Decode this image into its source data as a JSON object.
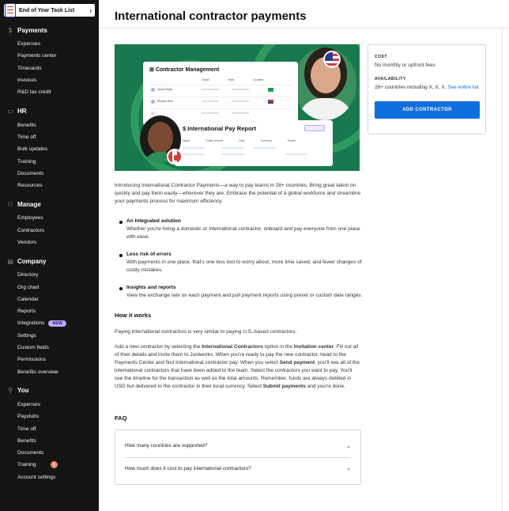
{
  "banner": {
    "text": "End of Year Task List",
    "chevron": "›"
  },
  "sidebar": {
    "sections": [
      {
        "title": "Payments",
        "icon": "dollar-icon",
        "glyph": "$",
        "items": [
          {
            "label": "Expenses"
          },
          {
            "label": "Payments center"
          },
          {
            "label": "Timecards"
          },
          {
            "label": "Invoices"
          },
          {
            "label": "R&D tax credit"
          }
        ]
      },
      {
        "title": "HR",
        "icon": "briefcase-icon",
        "glyph": "▭",
        "items": [
          {
            "label": "Benefits"
          },
          {
            "label": "Time off"
          },
          {
            "label": "Bulk updates"
          },
          {
            "label": "Training"
          },
          {
            "label": "Documents"
          },
          {
            "label": "Resources"
          }
        ]
      },
      {
        "title": "Manage",
        "icon": "people-icon",
        "glyph": "⚇",
        "items": [
          {
            "label": "Employees"
          },
          {
            "label": "Contractors"
          },
          {
            "label": "Vendors"
          }
        ]
      },
      {
        "title": "Company",
        "icon": "building-icon",
        "glyph": "▤",
        "items": [
          {
            "label": "Directory"
          },
          {
            "label": "Org chart"
          },
          {
            "label": "Calendar"
          },
          {
            "label": "Reports"
          },
          {
            "label": "Integrations",
            "badge": "NEW"
          },
          {
            "label": "Settings"
          },
          {
            "label": "Custom fields"
          },
          {
            "label": "Permissions"
          },
          {
            "label": "Benefits overview"
          }
        ]
      },
      {
        "title": "You",
        "icon": "person-icon",
        "glyph": "⚲",
        "items": [
          {
            "label": "Expenses"
          },
          {
            "label": "Paystubs"
          },
          {
            "label": "Time off"
          },
          {
            "label": "Benefits"
          },
          {
            "label": "Documents"
          },
          {
            "label": "Training",
            "count": "1"
          },
          {
            "label": "Account settings"
          }
        ]
      }
    ]
  },
  "header": {
    "title": "International contractor payments"
  },
  "hero": {
    "card1_title": "Contractor Management",
    "card1_cols": [
      "Email",
      "Rate",
      "Location"
    ],
    "card1_rows": [
      "Jacob Singh",
      "Ricardo Ruiz"
    ],
    "card2_title": "International Pay Report",
    "card2_pill": "View all ›",
    "card2_cols": [
      "Name",
      "Dollar Amount",
      "Date",
      "Currency",
      "Payee"
    ]
  },
  "main": {
    "intro": "Introducing International Contractor Payments—a way to pay teams in 28+ countries. Bring great talent on quickly and pay them easily—wherever they are. Embrace the potential of a global workforce and streamline your payments process for maximum efficiency.",
    "features": [
      {
        "title": "An integrated solution",
        "desc": "Whether you're hiring a domestic or international contractor, onboard and pay everyone from one place with ease."
      },
      {
        "title": "Less risk of errors",
        "desc": "With payments in one place, that's one less tool to worry about, more time saved, and fewer changes of costly mistakes."
      },
      {
        "title": "Insights and reports",
        "desc": "View the exchange rate on each payment and pull payment reports using preset or custom date ranges."
      }
    ],
    "how_title": "How it works",
    "how_p1": "Paying international contractors is very similar to paying U.S.-based contractors.",
    "how_p2": {
      "a": "Add a new contractor by selecting the ",
      "b": "International Contractors",
      "c": " option in the ",
      "d": "Invitation center",
      "e": ". Fill out all of their details and invite them to Justworks. When you're ready to pay the new contractor, head to the Payments Center and find International contractor pay. When you select ",
      "f": "Send payment",
      "g": ", you'll see all of the international contractors that have been added to the team. Select the contractors you want to pay. You'll see the timeline for the transaction as well as the total amounts. Remember, funds are always debited in USD but delivered to the contractor in their local currency. Select ",
      "h": "Submit payments",
      "i": " and you're done."
    },
    "faq_title": "FAQ",
    "faq": [
      {
        "q": "How many countries are supported?"
      },
      {
        "q": "How much does it cost to pay international contractors?"
      }
    ]
  },
  "panel": {
    "cost_label": "COST",
    "cost_value": "No monthly or upfront fees",
    "avail_label": "AVAILABILITY",
    "avail_value": "28+ countries including X, X, X. ",
    "avail_link": "See entire list",
    "button": "ADD CONTRACTOR"
  },
  "colors": {
    "sidebar_bg": "#141414",
    "hero_green": "#17794d",
    "primary_blue": "#0f6fde",
    "badge_purple": "#b8a8f5",
    "badge_orange": "#f08a6a"
  }
}
